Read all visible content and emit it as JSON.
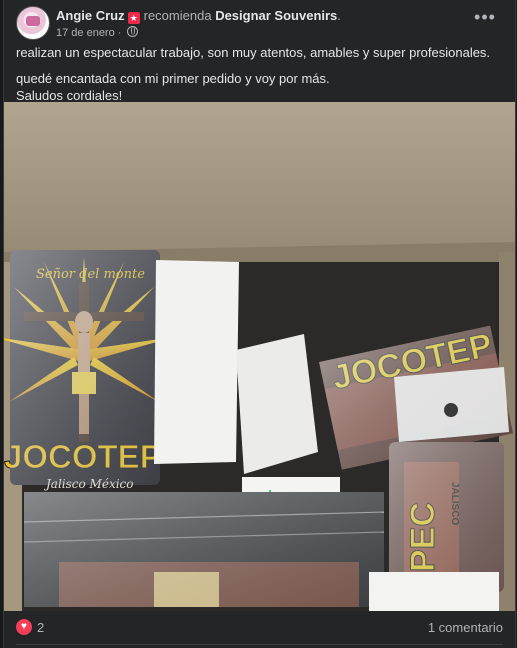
{
  "post": {
    "author": "Angie Cruz",
    "author_badge": "★",
    "action": "recomienda",
    "page_name": "Designar Souvenirs",
    "date": "17 de enero",
    "date_separator": "·",
    "more_icon": "more-options-icon",
    "more_label": "•••",
    "text_line_1": "realizan un espectacular trabajo, son muy atentos, amables y super profesionales.",
    "text_line_2": "quedé encantada con mi primer pedido y voy por más.",
    "text_line_3": "Saludos cordiales!",
    "photo": {
      "printed_words": [
        "JOCOTEPEC",
        "Jalisco México",
        "Señor del monte",
        "JALISCO",
        "México"
      ]
    },
    "reactions": {
      "icon": "heart-icon",
      "count": "2",
      "comments": "1 comentario"
    }
  },
  "colors": {
    "background": "#18191a",
    "card": "#242526",
    "text_primary": "#e4e6eb",
    "text_secondary": "#b0b3b8",
    "heart": "#f33e58",
    "badge": "#f02849"
  }
}
